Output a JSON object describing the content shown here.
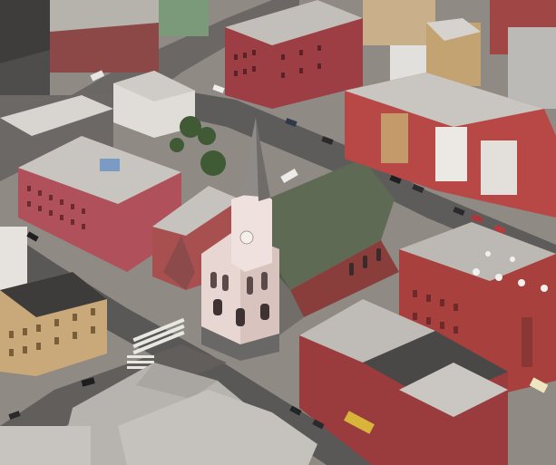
{
  "scene": {
    "kind": "aerial-photo",
    "subject": "church-with-spire",
    "colors": {
      "ground": "#8f8a84",
      "road": "#5e5c5a",
      "sidewalk": "#a8a39c",
      "brick": "#9c4a48",
      "brick_dark": "#7a3634",
      "brick_red": "#b0403e",
      "roof_gray": "#bdbab5",
      "roof_dark": "#5a5856",
      "roof_light": "#d4d1cc",
      "church_facade": "#e8d6d2",
      "church_roof": "#5f6a55",
      "tree": "#3f5a35",
      "tan": "#c9b08a",
      "shadow": "#3a3836"
    }
  }
}
